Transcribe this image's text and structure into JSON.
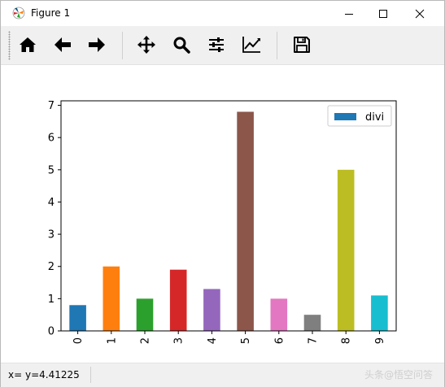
{
  "window": {
    "title": "Figure 1",
    "controls": [
      "minimize",
      "maximize",
      "close"
    ]
  },
  "toolbar": {
    "buttons": [
      {
        "name": "home",
        "icon": "home-icon"
      },
      {
        "name": "back",
        "icon": "arrow-left-icon"
      },
      {
        "name": "forward",
        "icon": "arrow-right-icon"
      },
      {
        "name": "pan",
        "icon": "move-icon"
      },
      {
        "name": "zoom",
        "icon": "magnifier-icon"
      },
      {
        "name": "subplots",
        "icon": "sliders-icon"
      },
      {
        "name": "edit-axis",
        "icon": "line-chart-icon"
      },
      {
        "name": "save",
        "icon": "floppy-disk-icon"
      }
    ]
  },
  "status": {
    "coords": "x= y=4.41225",
    "watermark": "头条@悟空问答"
  },
  "chart_data": {
    "type": "bar",
    "categories": [
      "0",
      "1",
      "2",
      "3",
      "4",
      "5",
      "6",
      "7",
      "8",
      "9"
    ],
    "series": [
      {
        "name": "divi",
        "values": [
          0.8,
          2.0,
          1.0,
          1.9,
          1.3,
          6.8,
          1.0,
          0.5,
          5.0,
          1.1
        ]
      }
    ],
    "bar_colors": [
      "#1f77b4",
      "#ff7f0e",
      "#2ca02c",
      "#d62728",
      "#9467bd",
      "#8c564b",
      "#e377c2",
      "#7f7f7f",
      "#bcbd22",
      "#17becf"
    ],
    "legend_color": "#1f77b4",
    "yticks": [
      "0",
      "1",
      "2",
      "3",
      "4",
      "5",
      "6",
      "7"
    ],
    "ylim": [
      0,
      7.14
    ],
    "xtick_rotation": 90,
    "legend_position": "top-right",
    "grid": false
  }
}
